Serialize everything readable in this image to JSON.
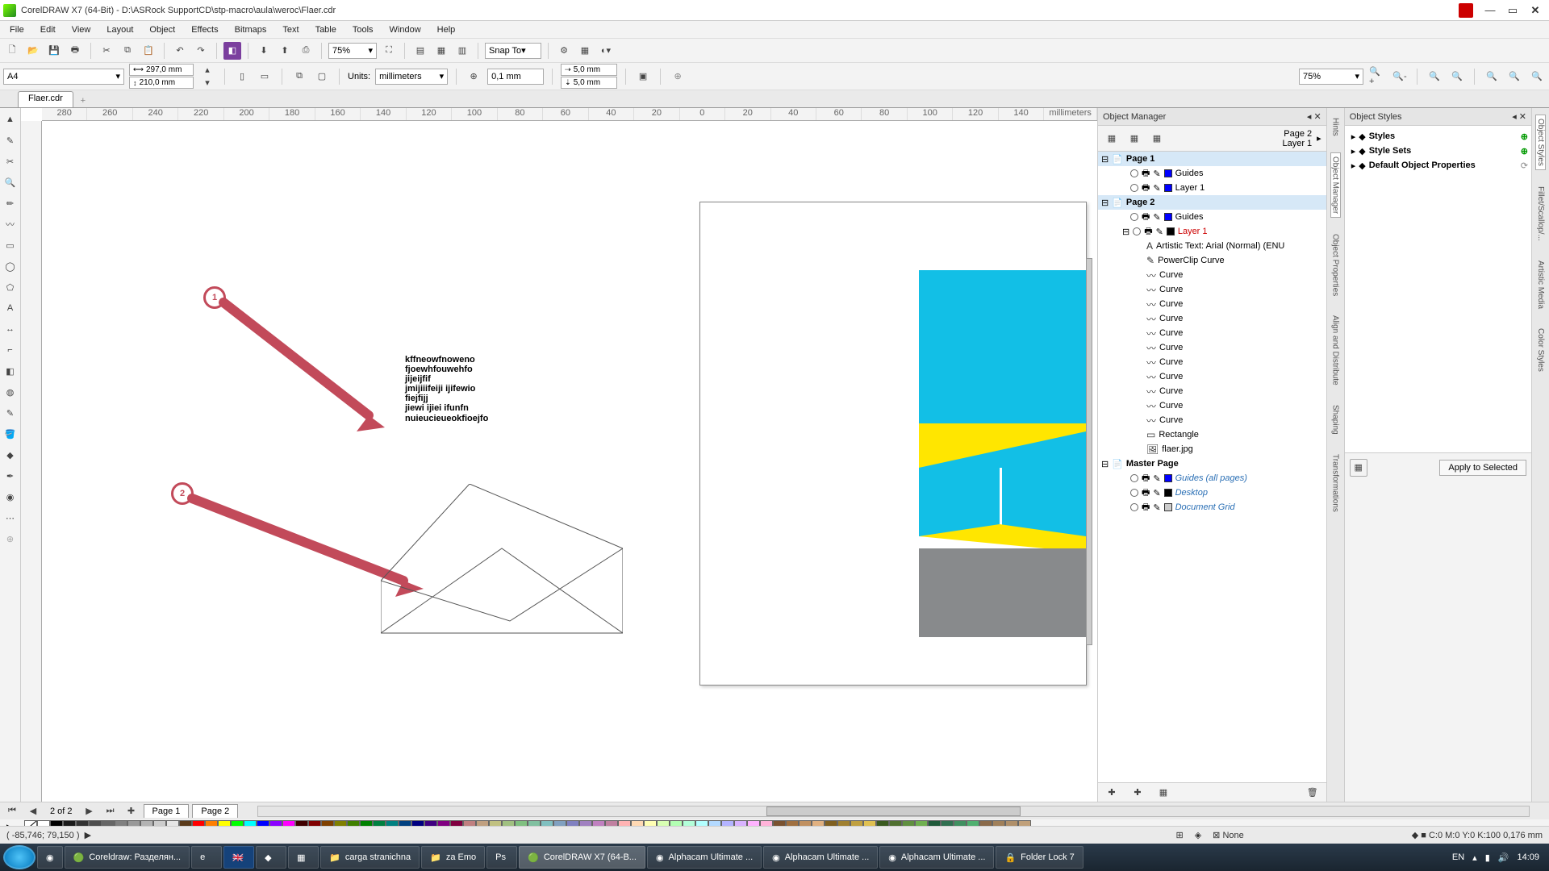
{
  "app": {
    "title": "CorelDRAW X7 (64-Bit) - D:\\ASRock SupportCD\\stp-macro\\aula\\weroc\\Flaer.cdr"
  },
  "menu": [
    "File",
    "Edit",
    "View",
    "Layout",
    "Object",
    "Effects",
    "Bitmaps",
    "Text",
    "Table",
    "Tools",
    "Window",
    "Help"
  ],
  "toolbar": {
    "zoom": "75%",
    "snap": "Snap To"
  },
  "property_bar": {
    "page_size": "A4",
    "width": "297,0 mm",
    "height": "210,0 mm",
    "units_label": "Units:",
    "units": "millimeters",
    "nudge": "0,1 mm",
    "dup_x": "5,0 mm",
    "dup_y": "5,0 mm",
    "zoom2": "75%"
  },
  "doc_tab": "Flaer.cdr",
  "ruler_marks": [
    "280",
    "260",
    "240",
    "220",
    "200",
    "180",
    "160",
    "140",
    "120",
    "100",
    "80",
    "60",
    "40",
    "20",
    "0",
    "20",
    "40",
    "60",
    "80",
    "100",
    "120",
    "140"
  ],
  "ruler_end": "millimeters",
  "canvas_text": [
    "kffneowfnoweno",
    "fjoewhfouwehfo",
    "jijeijfif",
    "jmijiiifeiji ijifewio",
    "fiejfijj",
    "jiewi ijiei ifunfn",
    "nuieucieueokfioejfo"
  ],
  "annotations": {
    "a1": "1",
    "a2": "2"
  },
  "object_manager": {
    "title": "Object Manager",
    "header_page": "Page 2",
    "header_layer": "Layer 1",
    "pages": [
      {
        "name": "Page 1",
        "layers": [
          "Guides",
          "Layer 1"
        ]
      },
      {
        "name": "Page 2",
        "layers": [
          "Guides",
          "Layer 1"
        ],
        "objects": [
          "Artistic Text: Arial (Normal) (ENU",
          "PowerClip Curve",
          "Curve",
          "Curve",
          "Curve",
          "Curve",
          "Curve",
          "Curve",
          "Curve",
          "Curve",
          "Curve",
          "Curve",
          "Curve",
          "Rectangle",
          "flaer.jpg"
        ]
      }
    ],
    "master": {
      "name": "Master Page",
      "items": [
        "Guides (all pages)",
        "Desktop",
        "Document Grid"
      ]
    }
  },
  "object_styles": {
    "title": "Object Styles",
    "items": [
      "Styles",
      "Style Sets",
      "Default Object Properties"
    ],
    "button": "Apply to Selected"
  },
  "side_tabs": [
    "Hints",
    "Object Manager",
    "Object Properties",
    "Align and Distribute",
    "Shaping",
    "Transformations"
  ],
  "side_tabs_right": [
    "Object Styles",
    "Fillet/Scallop/...",
    "Artistic Media",
    "Color Styles"
  ],
  "pager": {
    "info": "2 of 2",
    "pages": [
      "Page 1",
      "Page 2"
    ]
  },
  "status": {
    "coords": "( -85,746; 79,150 )",
    "fill": "None",
    "outline": "C:0 M:0 Y:0 K:100  0,176 mm"
  },
  "taskbar": {
    "items": [
      "Coreldraw: Разделян...",
      "",
      "",
      "",
      "carga stranichna",
      "za Emo",
      "",
      "CorelDRAW X7 (64-B...",
      "Alphacam Ultimate ...",
      "Alphacam Ultimate ...",
      "Alphacam Ultimate ...",
      "Folder Lock 7"
    ],
    "lang": "EN",
    "time": "14:09"
  },
  "palette_colors1": [
    "#FFFFFF",
    "#000000",
    "#1a1a1a",
    "#333",
    "#4d4d4d",
    "#666",
    "#808080",
    "#999",
    "#b3b3b3",
    "#ccc",
    "#e6e6e6",
    "#5a3a1a",
    "#f00",
    "#ff7f00",
    "#ff0",
    "#0f0",
    "#0ff",
    "#00f",
    "#8b00ff",
    "#ff00ff",
    "#400000",
    "#800000",
    "#804000",
    "#808000",
    "#408000",
    "#008000",
    "#008040",
    "#008080",
    "#004080",
    "#000080",
    "#400080",
    "#800080",
    "#800040",
    "#c08080",
    "#c0a080",
    "#c0c080",
    "#a0c080",
    "#80c080",
    "#80c0a0",
    "#80c0c0",
    "#80a0c0",
    "#8080c0",
    "#a080c0",
    "#c080c0",
    "#c080a0",
    "#ffb3b3",
    "#ffd9b3",
    "#ffffb3",
    "#d9ffb3",
    "#b3ffb3",
    "#b3ffd9",
    "#b3ffff",
    "#b3d9ff",
    "#b3b3ff",
    "#d9b3ff",
    "#ffb3ff",
    "#ffb3d9",
    "#7a5230",
    "#a07040",
    "#c09060",
    "#e0b080",
    "#806020",
    "#a08030",
    "#c0a040",
    "#e0c050",
    "#3a5a20",
    "#507030",
    "#609040",
    "#70b050",
    "#205a3a",
    "#307050",
    "#409060",
    "#50b070",
    "#8a6a4a",
    "#a0805a",
    "#b0906a",
    "#c0a07a"
  ],
  "palette_colors2": [
    "#000000",
    "#00aeef",
    "#fff200",
    "#808285",
    "#231f20"
  ]
}
